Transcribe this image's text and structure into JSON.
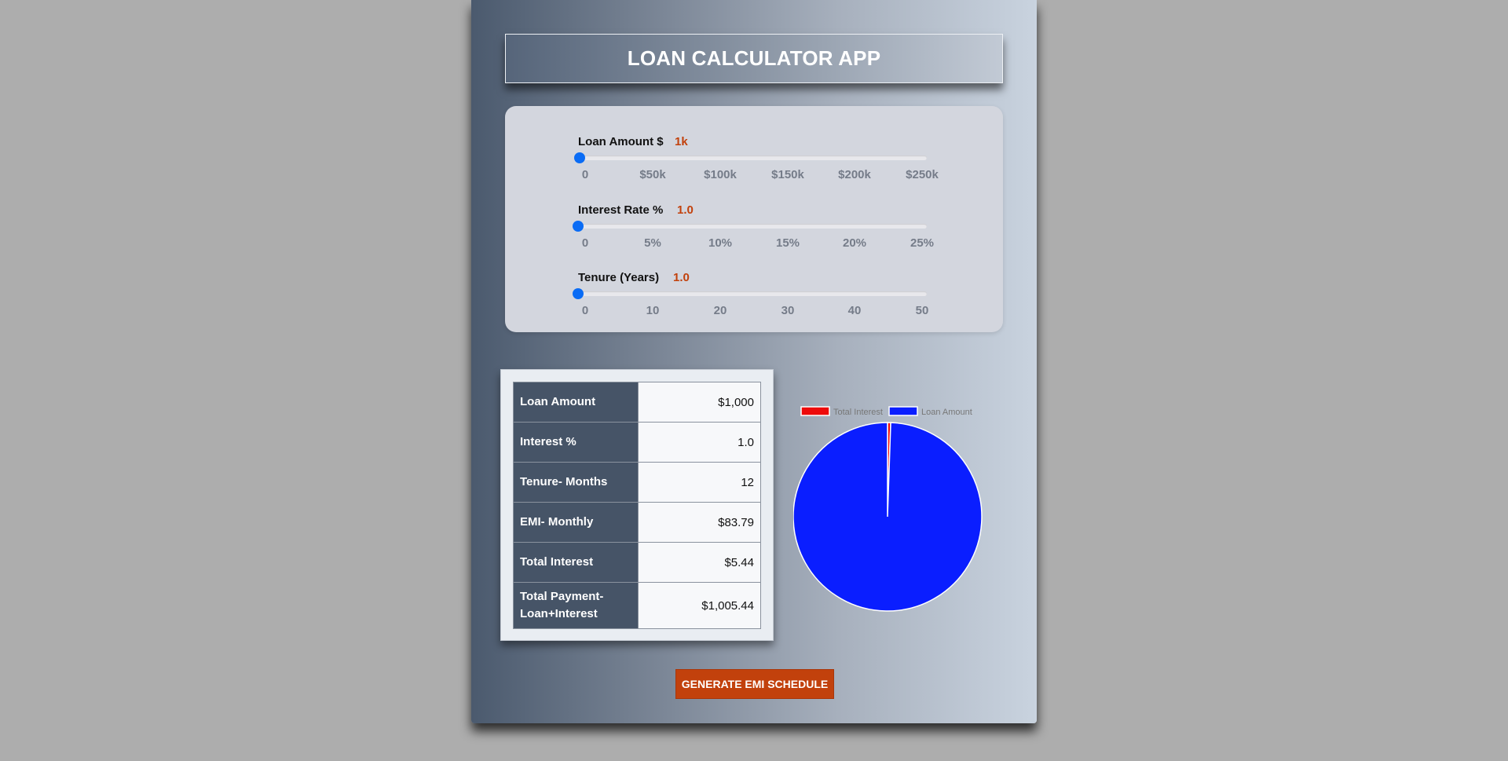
{
  "header": {
    "title": "LOAN CALCULATOR APP"
  },
  "sliders": {
    "loan": {
      "label": "Loan Amount $",
      "value": "1k",
      "fraction": 0.004,
      "ticks": [
        "0",
        "$50k",
        "$100k",
        "$150k",
        "$200k",
        "$250k"
      ]
    },
    "interest": {
      "label": "Interest Rate %",
      "value": "1.0",
      "fraction": 0.0,
      "ticks": [
        "0",
        "5%",
        "10%",
        "15%",
        "20%",
        "25%"
      ]
    },
    "tenure": {
      "label": "Tenure (Years)",
      "value": "1.0",
      "fraction": 0.0,
      "ticks": [
        "0",
        "10",
        "20",
        "30",
        "40",
        "50"
      ]
    }
  },
  "summary": {
    "rows": [
      {
        "label": "Loan Amount",
        "value": "$1,000"
      },
      {
        "label": "Interest %",
        "value": "1.0"
      },
      {
        "label": "Tenure- Months",
        "value": "12"
      },
      {
        "label": "EMI- Monthly",
        "value": "$83.79"
      },
      {
        "label": "Total Interest",
        "value": "$5.44"
      },
      {
        "label": "Total Payment- Loan+Interest",
        "value": "$1,005.44"
      }
    ]
  },
  "chart_data": {
    "type": "pie",
    "labels": [
      "Total Interest",
      "Loan Amount"
    ],
    "values": [
      5.44,
      1000
    ],
    "colors": [
      "#ee0a0a",
      "#0a1eff"
    ],
    "legend": "top"
  },
  "actions": {
    "generate_label": "GENERATE EMI SCHEDULE"
  },
  "colors": {
    "accent": "#c2410c",
    "slider": "#0a6cf5",
    "table_header": "#465467"
  }
}
